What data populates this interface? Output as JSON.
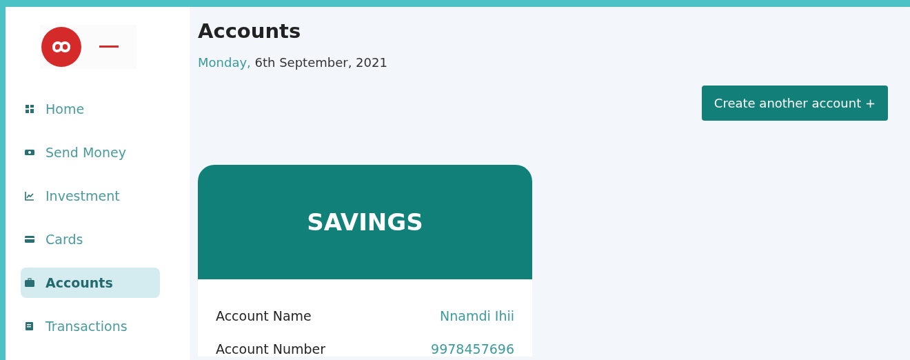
{
  "sidebar": {
    "items": [
      {
        "label": "Home",
        "selected": false
      },
      {
        "label": "Send Money",
        "selected": false
      },
      {
        "label": "Investment",
        "selected": false
      },
      {
        "label": "Cards",
        "selected": false
      },
      {
        "label": "Accounts",
        "selected": true
      },
      {
        "label": "Transactions",
        "selected": false
      }
    ]
  },
  "page": {
    "title": "Accounts",
    "date_day": "Monday,",
    "date_rest": "6th September, 2021",
    "create_button": "Create another account +"
  },
  "account_card": {
    "type": "SAVINGS",
    "rows": [
      {
        "label": "Account Name",
        "value": "Nnamdi Ihii"
      },
      {
        "label": "Account Number",
        "value": "9978457696"
      }
    ]
  }
}
